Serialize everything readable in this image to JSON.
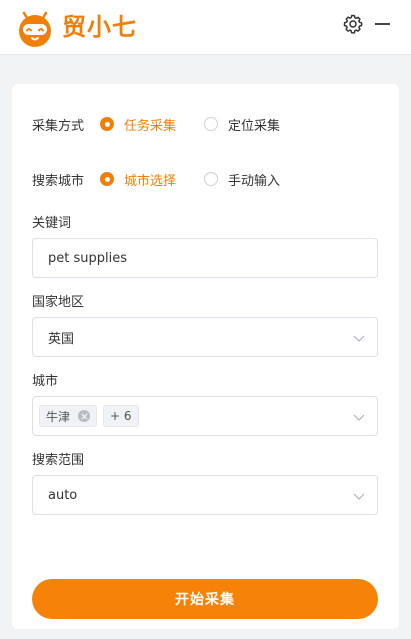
{
  "header": {
    "logo_text": "贸小七",
    "brand_color": "#f07f0a"
  },
  "form": {
    "collect_mode": {
      "label": "采集方式",
      "options": [
        {
          "label": "任务采集",
          "checked": true
        },
        {
          "label": "定位采集",
          "checked": false
        }
      ]
    },
    "search_city": {
      "label": "搜索城市",
      "options": [
        {
          "label": "城市选择",
          "checked": true
        },
        {
          "label": "手动输入",
          "checked": false
        }
      ]
    },
    "keyword": {
      "label": "关键词",
      "value": "pet supplies"
    },
    "country": {
      "label": "国家地区",
      "value": "英国"
    },
    "city": {
      "label": "城市",
      "tags": [
        "牛津"
      ],
      "more": "+ 6"
    },
    "range": {
      "label": "搜索范围",
      "value": "auto"
    },
    "submit_label": "开始采集"
  },
  "icons": {
    "logo": "robot-mascot-icon",
    "settings": "gear-icon",
    "minimize": "minimize-icon",
    "dropdown": "chevron-down-icon",
    "tag_remove": "close-circle-icon"
  }
}
